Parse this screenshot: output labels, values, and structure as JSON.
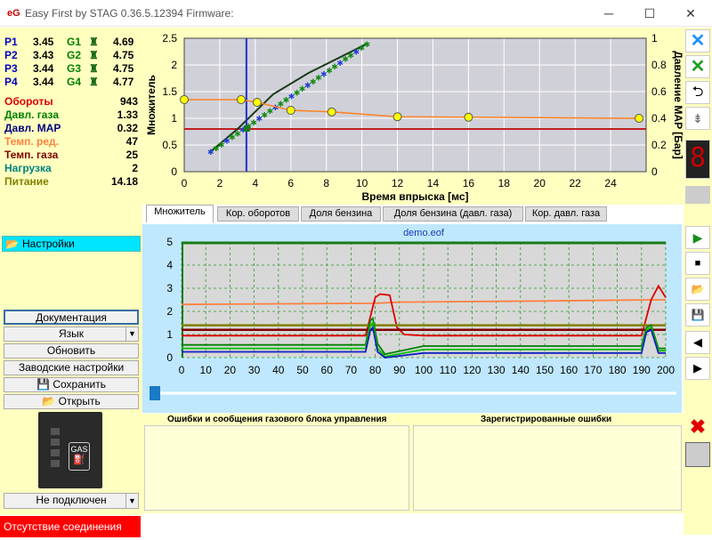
{
  "window": {
    "title": "Easy First by STAG 0.36.5.12394 Firmware:",
    "min": "─",
    "max": "☐",
    "close": "✕"
  },
  "pressures": [
    {
      "p": "P1",
      "pv": "3.45",
      "g": "G1",
      "gv": "4.69"
    },
    {
      "p": "P2",
      "pv": "3.43",
      "g": "G2",
      "gv": "4.75"
    },
    {
      "p": "P3",
      "pv": "3.44",
      "g": "G3",
      "gv": "4.75"
    },
    {
      "p": "P4",
      "pv": "3.44",
      "g": "G4",
      "gv": "4.77"
    }
  ],
  "stats": [
    {
      "label": "Обороты",
      "value": "943",
      "color": "#e00000"
    },
    {
      "label": "Давл. газа",
      "value": "1.33",
      "color": "#008000"
    },
    {
      "label": "Давл. MAP",
      "value": "0.32",
      "color": "#000080"
    },
    {
      "label": "Темп. ред.",
      "value": "47",
      "color": "#ff8040"
    },
    {
      "label": "Темп. газа",
      "value": "25",
      "color": "#800000"
    },
    {
      "label": "Нагрузка",
      "value": "2",
      "color": "#008080"
    },
    {
      "label": "Питание",
      "value": "14.18",
      "color": "#808000"
    }
  ],
  "left": {
    "settings": "Настройки",
    "docs": "Документация",
    "lang": "Язык",
    "update": "Обновить",
    "factory": "Заводские настройки",
    "save": "Сохранить",
    "open": "Открыть",
    "device": "Не подключен",
    "gas": "GAS",
    "status": "Отсутствие соединения"
  },
  "tabs": [
    "Множитель",
    "Кор. оборотов",
    "Доля бензина",
    "Доля бензина (давл. газа)",
    "Кор. давл. газа"
  ],
  "chart_data": [
    {
      "type": "scatter",
      "xlabel": "Время впрыска [мс]",
      "ylabel": "Множитель",
      "y2label": "Давление MAP [Бар]",
      "xlim": [
        0,
        26
      ],
      "ylim": [
        0,
        2.5
      ],
      "y2lim": [
        0,
        1
      ],
      "xticks": [
        0,
        2,
        4,
        6,
        8,
        10,
        12,
        14,
        16,
        18,
        20,
        22,
        24
      ],
      "yticks": [
        "0",
        "0.5",
        "1",
        "1.5",
        "2",
        "2.5"
      ],
      "y2ticks": [
        "0",
        "0.2",
        "0.4",
        "0.6",
        "0.8",
        "1"
      ],
      "grid": true,
      "multiplier_curve": {
        "x": [
          0,
          3.2,
          4.1,
          6,
          8.3,
          12,
          16,
          25.6
        ],
        "y": [
          1.35,
          1.35,
          1.3,
          1.15,
          1.12,
          1.03,
          1.02,
          1.0
        ]
      },
      "cursor_x": 3.5,
      "red_line_y": 0.8,
      "scatter_line": {
        "x": [
          1.5,
          3,
          5,
          7,
          10.3
        ],
        "y": [
          0.38,
          0.8,
          1.45,
          1.85,
          2.4
        ]
      }
    },
    {
      "type": "line",
      "title": "demo.eof",
      "xlim": [
        0,
        200
      ],
      "ylim": [
        0,
        5
      ],
      "xticks": [
        0,
        10,
        20,
        30,
        40,
        50,
        60,
        70,
        80,
        90,
        100,
        110,
        120,
        130,
        140,
        150,
        160,
        170,
        180,
        190,
        200
      ],
      "yticks": [
        0,
        1,
        2,
        3,
        4,
        5
      ],
      "grid": true,
      "series": [
        {
          "color": "#ff8040",
          "x": [
            0,
            80,
            90,
            150,
            195,
            200
          ],
          "y": [
            2.3,
            2.35,
            2.4,
            2.45,
            2.5,
            2.5
          ]
        },
        {
          "color": "#e00000",
          "x": [
            0,
            76,
            80,
            82,
            86,
            89,
            92,
            100,
            190,
            194,
            197,
            200
          ],
          "y": [
            0.95,
            0.95,
            2.6,
            2.75,
            2.7,
            1.3,
            1.0,
            0.95,
            0.95,
            2.5,
            3.1,
            2.6
          ]
        },
        {
          "color": "#808000",
          "x": [
            0,
            200
          ],
          "y": [
            1.4,
            1.4
          ]
        },
        {
          "color": "#800000",
          "x": [
            0,
            200
          ],
          "y": [
            1.2,
            1.2
          ]
        },
        {
          "color": "#008000",
          "x": [
            0,
            76,
            78,
            79,
            81,
            84,
            100,
            190,
            192,
            194,
            197,
            200
          ],
          "y": [
            0.55,
            0.55,
            1.6,
            1.7,
            0.6,
            0.15,
            0.5,
            0.5,
            1.3,
            1.4,
            0.4,
            0.4
          ]
        },
        {
          "color": "#00c000",
          "x": [
            0,
            76,
            78,
            79,
            81,
            84,
            100,
            190,
            192,
            194,
            197,
            200
          ],
          "y": [
            0.4,
            0.4,
            1.4,
            1.5,
            0.4,
            0.05,
            0.35,
            0.35,
            1.2,
            1.3,
            0.3,
            0.3
          ]
        },
        {
          "color": "#1020c0",
          "x": [
            0,
            76,
            78,
            79,
            81,
            84,
            100,
            190,
            192,
            194,
            197,
            200
          ],
          "y": [
            0.25,
            0.25,
            1.2,
            1.3,
            0.25,
            0.0,
            0.2,
            0.2,
            1.1,
            1.2,
            0.2,
            0.2
          ]
        }
      ]
    }
  ],
  "errors": {
    "left_title": "Ошибки и сообщения газового блока управления",
    "right_title": "Зарегистрированные ошибки"
  }
}
